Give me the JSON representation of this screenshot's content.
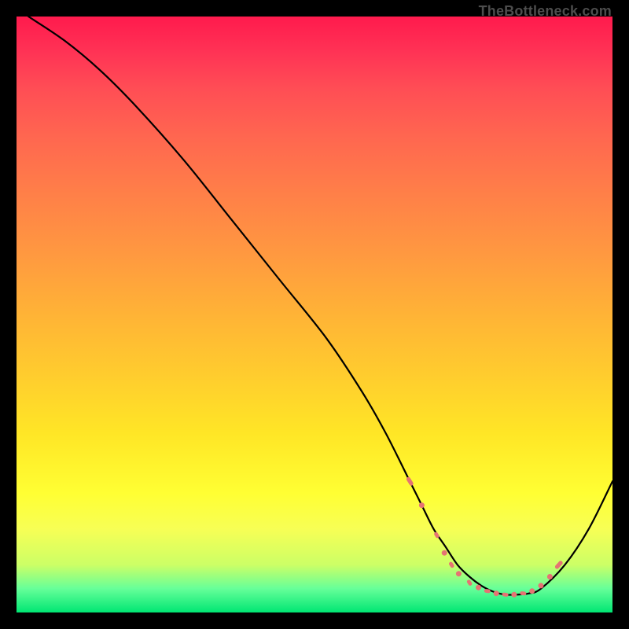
{
  "attribution": "TheBottleneck.com",
  "chart_data": {
    "type": "line",
    "title": "",
    "xlabel": "",
    "ylabel": "",
    "xlim": [
      0,
      100
    ],
    "ylim": [
      0,
      100
    ],
    "series": [
      {
        "name": "curve",
        "x": [
          2,
          8,
          14,
          20,
          28,
          36,
          44,
          52,
          58,
          62,
          66,
          68,
          70,
          72,
          74,
          76,
          78,
          80,
          82,
          84,
          86,
          88,
          92,
          96,
          100
        ],
        "y": [
          100,
          96,
          91,
          85,
          76,
          66,
          56,
          46,
          37,
          30,
          22,
          18,
          14,
          11,
          8,
          6,
          4.5,
          3.5,
          3,
          3,
          3.2,
          4,
          8,
          14,
          22
        ]
      }
    ],
    "markers": {
      "comment": "salmon highlight points near the trough",
      "points": [
        {
          "x": 66,
          "y": 22,
          "r": 2.6,
          "shape": "pill",
          "len": 3
        },
        {
          "x": 68,
          "y": 18,
          "r": 2.2,
          "shape": "dot"
        },
        {
          "x": 70.5,
          "y": 13,
          "r": 2.4,
          "shape": "pill",
          "len": 2
        },
        {
          "x": 71.8,
          "y": 10,
          "r": 2.2,
          "shape": "dot"
        },
        {
          "x": 73,
          "y": 8,
          "r": 2.4,
          "shape": "pill",
          "len": 2
        },
        {
          "x": 74.2,
          "y": 6.5,
          "r": 2.2,
          "shape": "dot"
        },
        {
          "x": 76,
          "y": 5,
          "r": 2.4,
          "shape": "pill",
          "len": 2
        },
        {
          "x": 77.5,
          "y": 4.2,
          "r": 2.2,
          "shape": "dot"
        },
        {
          "x": 79,
          "y": 3.6,
          "r": 2.4,
          "shape": "pill",
          "len": 2
        },
        {
          "x": 80.5,
          "y": 3.2,
          "r": 2.2,
          "shape": "dot"
        },
        {
          "x": 82,
          "y": 3.0,
          "r": 2.4,
          "shape": "pill",
          "len": 2
        },
        {
          "x": 83.5,
          "y": 3.0,
          "r": 2.2,
          "shape": "dot"
        },
        {
          "x": 85,
          "y": 3.2,
          "r": 2.4,
          "shape": "pill",
          "len": 2
        },
        {
          "x": 86.5,
          "y": 3.6,
          "r": 2.2,
          "shape": "dot"
        },
        {
          "x": 88,
          "y": 4.5,
          "r": 2.2,
          "shape": "dot"
        },
        {
          "x": 89.5,
          "y": 6,
          "r": 2.2,
          "shape": "dot"
        },
        {
          "x": 91,
          "y": 8,
          "r": 2.6,
          "shape": "pill",
          "len": 3
        }
      ]
    },
    "background_gradient": {
      "top": "#ff1a4d",
      "bottom": "#00e673"
    }
  }
}
